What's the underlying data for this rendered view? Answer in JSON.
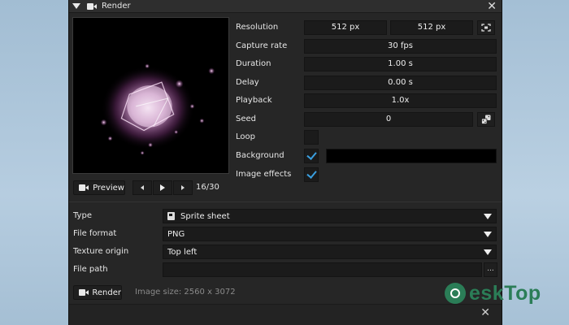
{
  "window": {
    "title": "Render"
  },
  "controls": {
    "preview_label": "Preview",
    "frame_counter": "16/30"
  },
  "properties": {
    "resolution": {
      "label": "Resolution",
      "width": "512 px",
      "height": "512 px"
    },
    "capture_rate": {
      "label": "Capture rate",
      "value": "30 fps"
    },
    "duration": {
      "label": "Duration",
      "value": "1.00 s"
    },
    "delay": {
      "label": "Delay",
      "value": "0.00 s"
    },
    "playback": {
      "label": "Playback",
      "value": "1.0x"
    },
    "seed": {
      "label": "Seed",
      "value": "0"
    },
    "loop": {
      "label": "Loop",
      "checked": false
    },
    "background": {
      "label": "Background",
      "checked": true,
      "color": "#000000"
    },
    "image_effects": {
      "label": "Image effects",
      "checked": true
    }
  },
  "export": {
    "type": {
      "label": "Type",
      "value": "Sprite sheet"
    },
    "file_format": {
      "label": "File format",
      "value": "PNG"
    },
    "texture_origin": {
      "label": "Texture origin",
      "value": "Top left"
    },
    "file_path": {
      "label": "File path",
      "value": "",
      "browse_label": "..."
    }
  },
  "footer": {
    "render_label": "Render",
    "image_size": "Image size: 2560 x 3072"
  },
  "watermark": {
    "text": "eskTop"
  },
  "colors": {
    "accent": "#3a9fe0",
    "panel": "#262626",
    "field": "#1b1b1b",
    "watermark": "#2b7d57"
  }
}
